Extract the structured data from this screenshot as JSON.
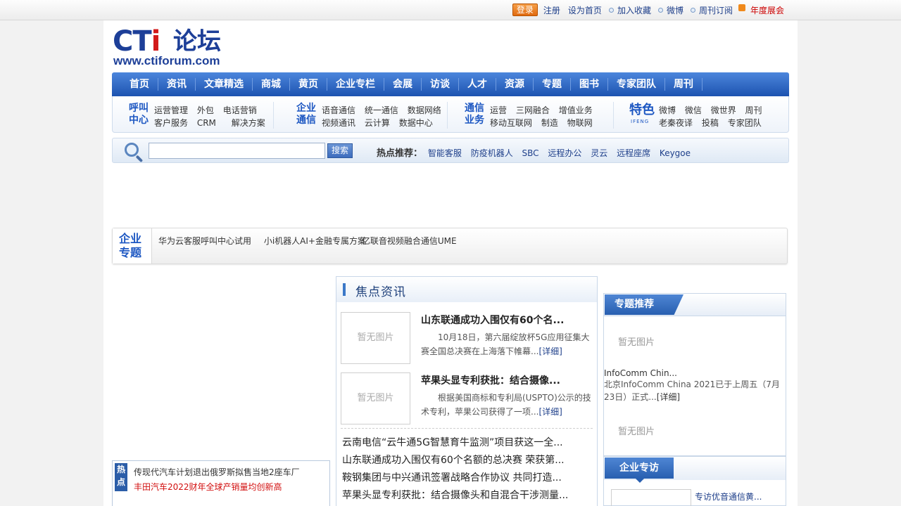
{
  "topbar": {
    "login": "登录",
    "links": [
      "注册",
      "设为首页",
      "加入收藏",
      "微博",
      "周刊订阅",
      "年度展会"
    ]
  },
  "logo": {
    "cti_prefix": "CT",
    "cti_i": "i",
    "cn": "论坛",
    "url": "www.ctiforum.com"
  },
  "nav": {
    "items": [
      "首页",
      "资讯",
      "文章精选",
      "商城",
      "黄页",
      "企业专栏",
      "会展",
      "访谈",
      "人才",
      "资源",
      "专题",
      "图书",
      "专家团队",
      "周刊"
    ]
  },
  "subnav": {
    "call_center": {
      "title_line1": "呼叫",
      "title_line2": "中心",
      "row1": [
        "运营管理",
        "外包",
        "电话营销"
      ],
      "row2": [
        "客户服务",
        "CRM",
        "解决方案"
      ]
    },
    "enterprise_comm": {
      "title_line1": "企业",
      "title_line2": "通信",
      "row1": [
        "语音通信",
        "统一通信",
        "数据网络"
      ],
      "row2": [
        "视频通讯",
        "云计算",
        "数据中心"
      ]
    },
    "telecom_biz": {
      "title_line1": "通信",
      "title_line2": "业务",
      "row1": [
        "运营",
        "三网融合",
        "增值业务"
      ],
      "row2": [
        "移动互联网",
        "制造",
        "物联网"
      ]
    },
    "featured": {
      "title": "特色",
      "subtitle": "IFENG",
      "row1": [
        "微博",
        "微信",
        "微世界",
        "周刊"
      ],
      "row2": [
        "老秦夜译",
        "投稿",
        "专家团队"
      ]
    }
  },
  "search": {
    "placeholder": "",
    "button": "搜索",
    "hot_label": "热点推荐：",
    "hot_keywords": [
      "智能客服",
      "防疫机器人",
      "SBC",
      "远程办公",
      "灵云",
      "远程座席",
      "Keygoe"
    ]
  },
  "topics": {
    "label_line1": "企业",
    "label_line2": "专题",
    "items": [
      "华为云客服呼叫中心试用",
      "小i机器人AI+金融专属方案",
      "亿联音视频融合通信UME"
    ]
  },
  "ticker": {
    "tag": "热点",
    "news1": "传现代汽车计划退出俄罗斯拟售当地2座车厂",
    "news2": "丰田汽车2022财年全球产销量均创新高"
  },
  "focus": {
    "title": "焦点资讯",
    "no_image": "暂无图片",
    "more": "[详细]",
    "featured": [
      {
        "title": "山东联通成功入围仅有60个名...",
        "desc": "10月18日，第六届绽放杯5G应用征集大赛全国总决赛在上海落下帷幕..."
      },
      {
        "title": "苹果头显专利获批：结合摄像...",
        "desc": "根据美国商标和专利局(USPTO)公示的技术专利，苹果公司获得了一项..."
      }
    ],
    "list": [
      "云南电信“云牛通5G智慧育牛监测”项目获这一全...",
      "山东联通成功入围仅有60个名额的总决赛 荣获第...",
      "鞍钢集团与中兴通讯签署战略合作协议 共同打造...",
      "苹果头显专利获批：结合摄像头和自混合干涉测量..."
    ]
  },
  "special": {
    "title": "专题推荐",
    "no_image": "暂无图片",
    "item_title": "InfoComm Chin...",
    "item_desc": "北京InfoComm China 2021已于上周五（7月23日）正式...",
    "more": "[详细]"
  },
  "visit": {
    "title": "企业专访",
    "item_title": "专访优音通信黄..."
  }
}
